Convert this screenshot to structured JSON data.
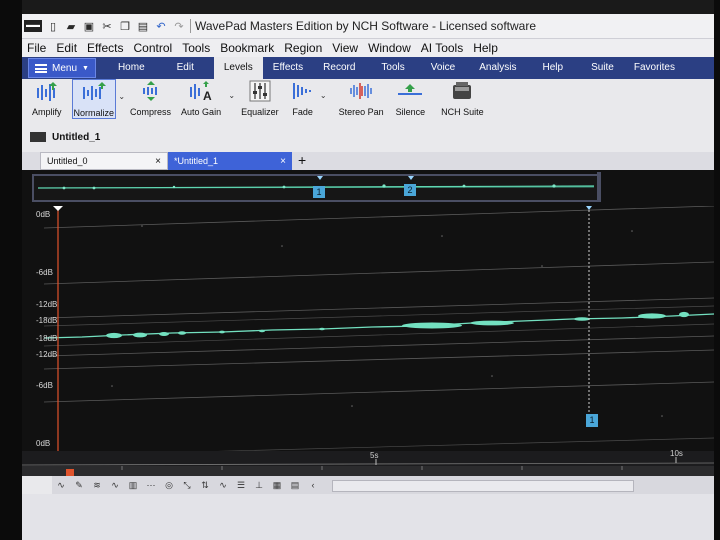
{
  "window": {
    "title": "WavePad Masters Edition by NCH Software - Licensed software"
  },
  "menubar": {
    "items": [
      "File",
      "Edit",
      "Effects",
      "Control",
      "Tools",
      "Bookmark",
      "Region",
      "View",
      "Window",
      "AI Tools",
      "Help"
    ]
  },
  "ribbon": {
    "menu_label": "Menu",
    "tabs": [
      "Home",
      "Edit",
      "Levels",
      "Effects",
      "Record",
      "Tools",
      "Voice",
      "Analysis",
      "Help",
      "Suite",
      "Favorites"
    ],
    "active_tab": "Levels"
  },
  "toolbar": {
    "items": [
      {
        "label": "Amplify",
        "icon": "amplify-icon"
      },
      {
        "label": "Normalize",
        "icon": "normalize-icon"
      },
      {
        "label": "Compress",
        "icon": "compress-icon"
      },
      {
        "label": "Auto Gain",
        "icon": "auto-gain-icon"
      },
      {
        "label": "Equalizer",
        "icon": "equalizer-icon"
      },
      {
        "label": "Fade",
        "icon": "fade-icon"
      },
      {
        "label": "Stereo Pan",
        "icon": "stereo-pan-icon"
      },
      {
        "label": "Silence",
        "icon": "silence-icon"
      },
      {
        "label": "NCH Suite",
        "icon": "nch-suite-icon"
      }
    ]
  },
  "file": {
    "name": "Untitled_1"
  },
  "doc_tabs": [
    {
      "label": "Untitled_0",
      "close": "×"
    },
    {
      "label": "*Untitled_1",
      "close": "×"
    }
  ],
  "doc_tab_add": "+",
  "overview": {
    "markers": [
      "1",
      "2"
    ]
  },
  "waveform": {
    "db_labels": [
      "0dB",
      "-6dB",
      "-12dB",
      "-18dB",
      "-18dB",
      "-12dB",
      "-6dB",
      "0dB"
    ],
    "bookmark_label": "1",
    "colors": {
      "wave": "#73e0c0",
      "background": "#111111",
      "cursor": "#e0532c"
    }
  },
  "ruler": {
    "labels": [
      "5s",
      "10s"
    ]
  },
  "bottom_toolbar": {
    "scroll_left": "‹"
  }
}
